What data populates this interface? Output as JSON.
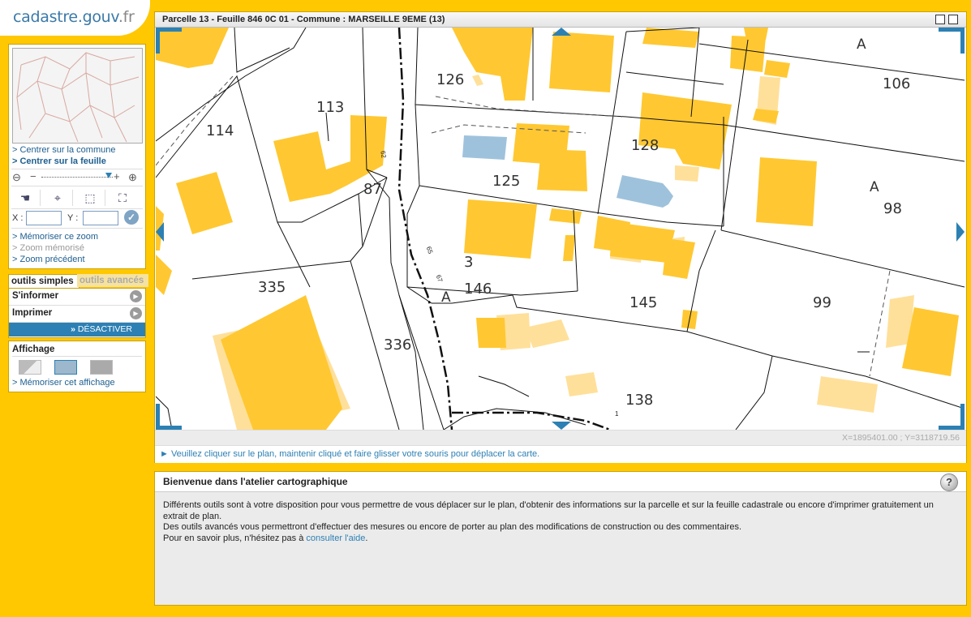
{
  "logo": {
    "text": "cadastre.gouv",
    "tld": ".fr"
  },
  "nav": {
    "center_commune": "> Centrer sur la commune",
    "center_sheet": "> Centrer sur la feuille",
    "x_label": "X :",
    "y_label": "Y :",
    "memorize_zoom": "> Mémoriser ce zoom",
    "memorized_zoom": "> Zoom mémorisé",
    "previous_zoom": "> Zoom précédent"
  },
  "tools": {
    "tab_simple": "outils simples",
    "tab_advanced": "outils avancés",
    "inform": "S'informer",
    "print": "Imprimer",
    "deactivate": "DÉSACTIVER"
  },
  "display": {
    "title": "Affichage",
    "memorize": "> Mémoriser cet affichage"
  },
  "map": {
    "title": "Parcelle 13 - Feuille 846 0C 01 - Commune : MARSEILLE 9EME (13)",
    "coords": "X=1895401.00 ; Y=3118719.56",
    "status": "► Veuillez cliquer sur le plan, maintenir cliqué et faire glisser votre souris pour déplacer la carte.",
    "labels": {
      "p126": "126",
      "p106": "106",
      "p113": "113",
      "p114": "114",
      "p128": "128",
      "p125": "125",
      "p87": "87",
      "p98": "98",
      "p3": "3",
      "p146": "146",
      "p335": "335",
      "p145": "145",
      "p99": "99",
      "p336": "336",
      "p138": "138",
      "sA1": "A",
      "sA2": "A",
      "sA3": "A",
      "small62": "62",
      "small65": "65",
      "small67": "67",
      "small1": "1"
    }
  },
  "info": {
    "title": "Bienvenue dans l'atelier cartographique",
    "line1": "Différents outils sont à votre disposition pour vous permettre de vous déplacer sur le plan, d'obtenir des informations sur la parcelle et sur la feuille cadastrale ou encore d'imprimer gratuitement un extrait de plan.",
    "line2": "Des outils avancés vous permettront d'effectuer des mesures ou encore de porter au plan des modifications de construction ou des commentaires.",
    "line3_prefix": "Pour en savoir plus, n'hésitez pas à ",
    "line3_link": "consulter l'aide",
    "line3_suffix": "."
  },
  "colors": {
    "background": "#ffc800",
    "building": "#ffc832",
    "building_light": "#ffe09a",
    "water": "#9fc2dc",
    "accent": "#2c80b4"
  }
}
